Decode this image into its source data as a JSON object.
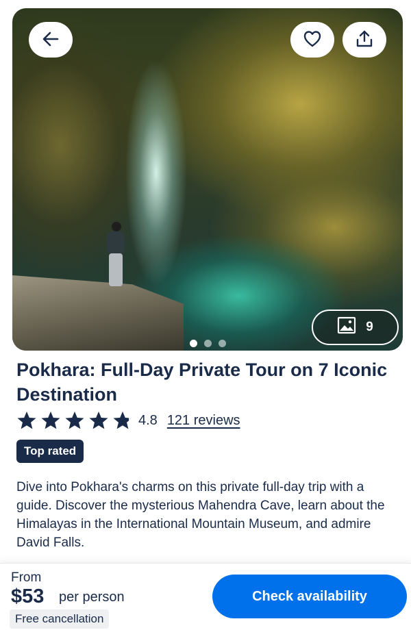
{
  "hero": {
    "photo_count": "9",
    "active_dot": 1,
    "dot_count": 3
  },
  "icons": {
    "back": "arrow-left-icon",
    "wishlist": "heart-icon",
    "share": "share-upload-icon",
    "gallery": "image-icon",
    "rating_star": "star-icon"
  },
  "product": {
    "title": "Pokhara: Full-Day Private Tour on 7 Iconic Destination",
    "rating_value": "4.8",
    "rating_stars": 4.8,
    "reviews_label": "121 reviews",
    "badge": "Top rated",
    "description": "Dive into Pokhara's charms on this private full-day trip with a guide. Discover the mysterious Mahendra Cave, learn about the Himalayas in the International Mountain Museum, and admire David Falls."
  },
  "footer": {
    "from_label": "From",
    "price": "$53",
    "per_person": "per person",
    "free_cancellation": "Free cancellation",
    "cta_label": "Check availability"
  },
  "colors": {
    "primary_text": "#1a2b49",
    "cta": "#0071eb",
    "badge_bg": "#1a2b49"
  }
}
